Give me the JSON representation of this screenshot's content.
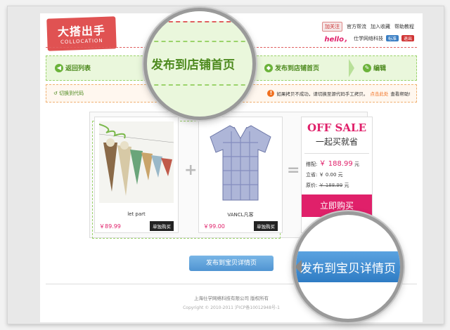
{
  "header": {
    "logo_cn": "大搭出手",
    "logo_en": "COLLOCATION",
    "follow_label": "加关注",
    "links": [
      "官方帮流",
      "加入收藏",
      "帮助教程"
    ],
    "hello": "hello，",
    "username": "仕学网络科技",
    "badge_blue": "标准",
    "logout": "退出"
  },
  "steps": {
    "back": "返回列表",
    "publish_store": "发布到店铺首页",
    "edit": "编辑"
  },
  "warn": {
    "switch_code": "切换到代码",
    "message": "如果拷贝不成功，请切换至源代码手工拷贝。",
    "click_here": "点击此处",
    "help": "查看帮助!"
  },
  "combo": {
    "items": [
      {
        "name": "let part",
        "price": "￥89.99",
        "buy": "单独购买"
      },
      {
        "name": "VANCL凡客",
        "price": "￥99.00",
        "buy": "单独购买"
      }
    ],
    "plus": "+",
    "equals": "=",
    "sale": {
      "title": "OFF SALE",
      "subtitle": "一起买就省",
      "match_label": "搭配:",
      "match_price": "￥ 188.99",
      "match_unit": "元",
      "save_label": "立省:",
      "save_price": "￥ 0.00",
      "save_unit": "元",
      "orig_label": "原价:",
      "orig_price": "￥ 188.99",
      "orig_unit": "元",
      "buy_now": "立即购买"
    }
  },
  "publish_item_button": "发布到宝贝详情页",
  "footer": {
    "company": "上海仕学网络科技有限公司 版权所有",
    "copyright": "Copyright © 2010-2011 沪ICP备10012948号-1"
  },
  "magnifier": {
    "store_text": "发布到店铺首页",
    "item_text": "发布到宝贝详情页"
  }
}
